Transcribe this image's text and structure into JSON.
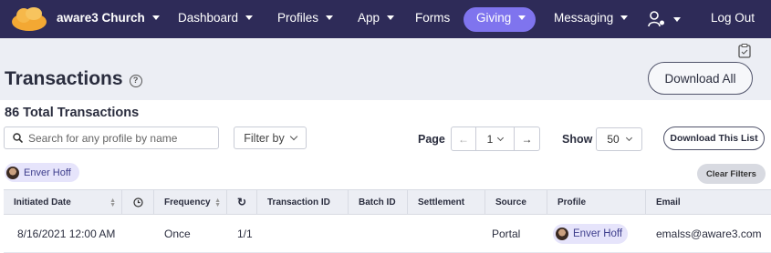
{
  "nav": {
    "brand": "aware3 Church",
    "items": [
      {
        "label": "Dashboard"
      },
      {
        "label": "Profiles"
      },
      {
        "label": "App"
      },
      {
        "label": "Forms"
      },
      {
        "label": "Giving"
      },
      {
        "label": "Messaging"
      },
      {
        "label": "Log Out"
      }
    ],
    "active": "Giving",
    "colors": {
      "bar": "#2e2b58",
      "active_pill": "#7f74ee",
      "logo": "#f3a833"
    }
  },
  "page": {
    "title": "Transactions",
    "help_icon": "question-circle-icon",
    "download_all": "Download All",
    "total": "86 Total Transactions"
  },
  "controls": {
    "search_placeholder": "Search for any profile by name",
    "filter_label": "Filter by",
    "page_label": "Page",
    "page_value": "1",
    "show_label": "Show",
    "show_value": "50",
    "download_list": "Download This List",
    "clear_filters": "Clear Filters"
  },
  "filter_chip": {
    "name": "Enver Hoff"
  },
  "table": {
    "headers": [
      "Initiated Date",
      "",
      "Frequency",
      "",
      "Transaction ID",
      "Batch ID",
      "Settlement",
      "Source",
      "Profile",
      "Email"
    ],
    "rows": [
      {
        "initiated_date": "8/16/2021 12:00 AM",
        "time": "",
        "frequency": "Once",
        "recurrence": "1/1",
        "transaction_id": "",
        "batch_id": "",
        "settlement": "",
        "source": "Portal",
        "profile": "Enver Hoff",
        "email": "emalss@aware3.com"
      }
    ]
  }
}
